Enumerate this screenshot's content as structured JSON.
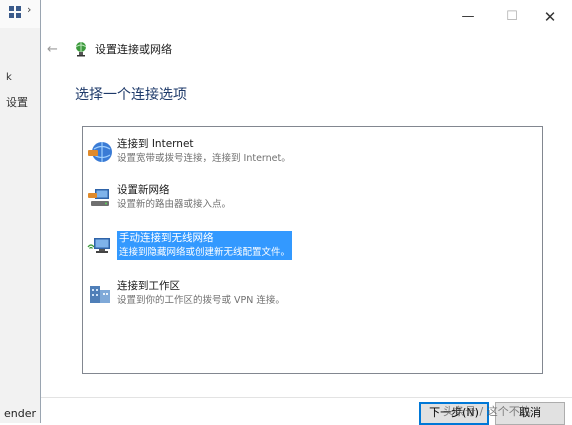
{
  "background_window": {
    "fragment1": "k",
    "fragment2": "设置",
    "fragment3": "ender I"
  },
  "dialog": {
    "title": "设置连接或网络",
    "heading": "选择一个连接选项",
    "options": [
      {
        "title": "连接到 Internet",
        "desc": "设置宽带或拨号连接，连接到 Internet。",
        "icon": "globe-network-icon",
        "selected": false
      },
      {
        "title": "设置新网络",
        "desc": "设置新的路由器或接入点。",
        "icon": "router-network-icon",
        "selected": false
      },
      {
        "title": "手动连接到无线网络",
        "desc": "连接到隐藏网络或创建新无线配置文件。",
        "icon": "wireless-computer-icon",
        "selected": true
      },
      {
        "title": "连接到工作区",
        "desc": "设置到你的工作区的拨号或 VPN 连接。",
        "icon": "workplace-icon",
        "selected": false
      }
    ],
    "buttons": {
      "next": "下一步(N)",
      "cancel": "取消"
    },
    "watermark": "头条号 / 这个不热"
  },
  "colors": {
    "selection": "#3399ff",
    "heading": "#1e3a6a",
    "accent_border": "#0078d7"
  }
}
